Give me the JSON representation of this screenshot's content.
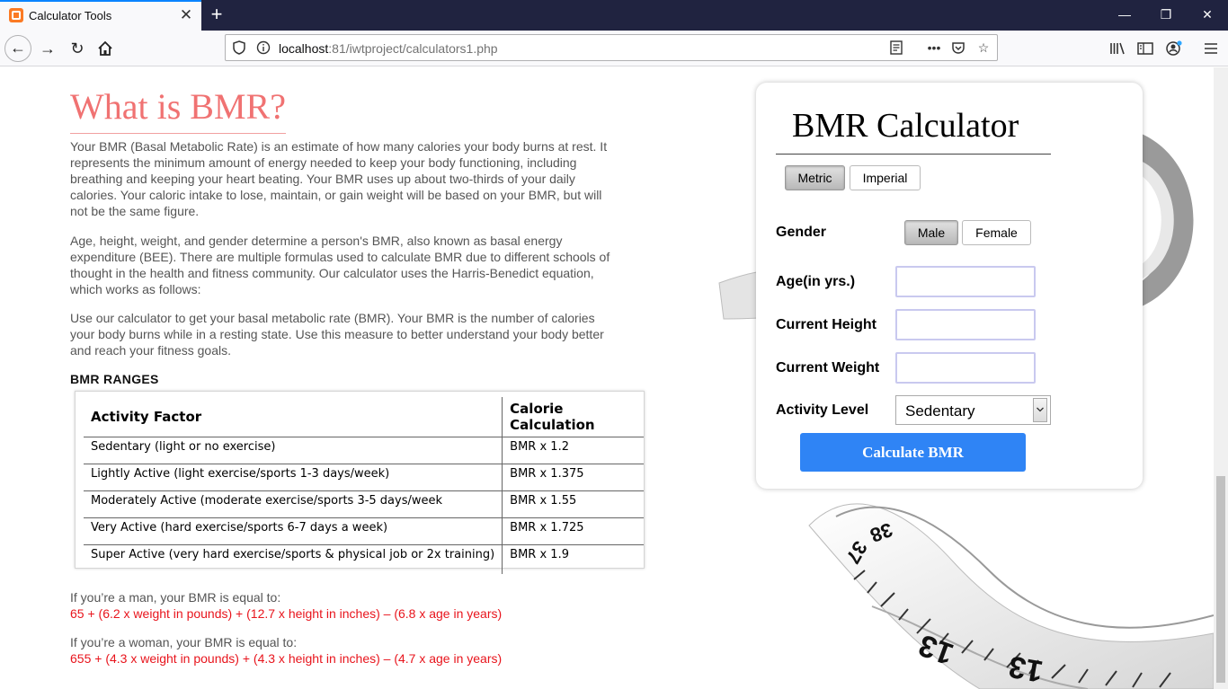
{
  "browser": {
    "tab_title": "Calculator Tools",
    "tab_close": "✕",
    "new_tab": "+",
    "url_host": "localhost",
    "url_rest": ":81/iwtproject/calculators1.php",
    "window_controls": {
      "minimize": "—",
      "maximize": "❐",
      "close": "✕"
    }
  },
  "article": {
    "title": "What is BMR?",
    "paragraphs": [
      "Your BMR (Basal Metabolic Rate) is an estimate of how many calories your body burns at rest. It represents the minimum amount of energy needed to keep your body functioning, including breathing and keeping your heart beating. Your BMR uses up about two-thirds of your daily calories. Your caloric intake to lose, maintain, or gain weight will be based on your BMR, but will not be the same figure.",
      "Age, height, weight, and gender determine a person's BMR, also known as basal energy expenditure (BEE). There are multiple formulas used to calculate BMR due to different schools of thought in the health and fitness community. Our calculator uses the Harris-Benedict equation, which works as follows:",
      "Use our calculator to get your basal metabolic rate (BMR). Your BMR is the number of calories your body burns while in a resting state. Use this measure to better understand your body better and reach your fitness goals."
    ],
    "ranges_heading": "BMR RANGES",
    "table": {
      "headers": [
        "Activity Factor",
        "Calorie Calculation"
      ],
      "rows": [
        [
          "Sedentary (light or no exercise)",
          "BMR x 1.2"
        ],
        [
          "Lightly Active (light exercise/sports 1-3 days/week)",
          "BMR x 1.375"
        ],
        [
          "Moderately Active (moderate exercise/sports 3-5 days/week",
          "BMR x 1.55"
        ],
        [
          "Very Active (hard exercise/sports 6-7 days a week)",
          "BMR x 1.725"
        ],
        [
          "Super Active (very hard exercise/sports & physical job or 2x training)",
          "BMR x 1.9"
        ]
      ]
    },
    "man_label": "If you’re a man, your BMR is equal to:",
    "man_formula": "65 + (6.2 x weight in pounds) + (12.7 x height in inches) – (6.8 x age in years)",
    "woman_label": "If you’re a woman, your BMR is equal to:",
    "woman_formula": "655 + (4.3 x weight in pounds) + (4.3 x height in inches) – (4.7 x age in years)"
  },
  "calculator": {
    "title": "BMR Calculator",
    "units": {
      "metric": "Metric",
      "imperial": "Imperial",
      "selected": "Metric"
    },
    "gender": {
      "label": "Gender",
      "male": "Male",
      "female": "Female",
      "selected": "Male"
    },
    "age_label": "Age(in yrs.)",
    "age_value": "",
    "height_label": "Current Height",
    "height_value": "",
    "weight_label": "Current Weight",
    "weight_value": "",
    "activity_label": "Activity Level",
    "activity_selected": "Sedentary",
    "submit_label": "Calculate BMR"
  },
  "colors": {
    "heading": "#f07272",
    "formula": "#e8141c",
    "button": "#2f84f5"
  }
}
